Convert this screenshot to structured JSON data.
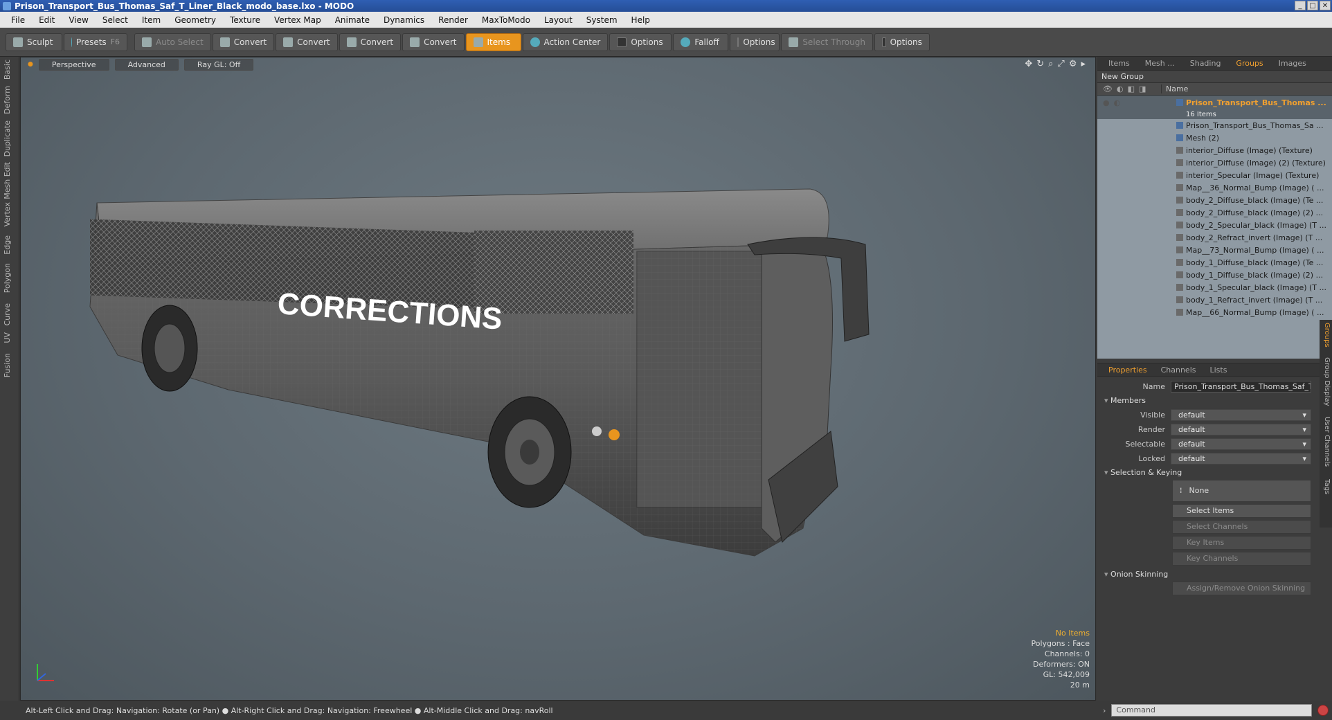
{
  "window": {
    "title": "Prison_Transport_Bus_Thomas_Saf_T_Liner_Black_modo_base.lxo - MODO"
  },
  "menu": [
    "File",
    "Edit",
    "View",
    "Select",
    "Item",
    "Geometry",
    "Texture",
    "Vertex Map",
    "Animate",
    "Dynamics",
    "Render",
    "MaxToModo",
    "Layout",
    "System",
    "Help"
  ],
  "toolbar": {
    "sculpt": "Sculpt",
    "presets": "Presets",
    "presets_key": "F6",
    "auto_select": "Auto Select",
    "convert1": "Convert",
    "convert2": "Convert",
    "convert3": "Convert",
    "convert4": "Convert",
    "items": "Items",
    "action_center": "Action Center",
    "options1": "Options",
    "falloff": "Falloff",
    "options2": "Options",
    "select_through": "Select Through",
    "options3": "Options"
  },
  "left_tabs": [
    "Basic",
    "Deform",
    "Duplicate",
    "Mesh Edit",
    "Vertex",
    "Edge",
    "Polygon",
    "Curve",
    "UV",
    "Fusion"
  ],
  "viewport": {
    "view_mode": "Perspective",
    "shading": "Advanced",
    "raygl": "Ray GL: Off",
    "bus_label": "CORRECTIONS",
    "info": {
      "items": "No Items",
      "polygons": "Polygons : Face",
      "channels": "Channels: 0",
      "deformers": "Deformers: ON",
      "gl": "GL: 542,009",
      "scale": "20 m"
    }
  },
  "right_panel": {
    "tabs": [
      "Items",
      "Mesh ...",
      "Shading",
      "Groups",
      "Images"
    ],
    "active_tab": "Groups",
    "new_group": "New Group",
    "name_header": "Name",
    "group": {
      "name": "Prison_Transport_Bus_Thomas ...",
      "count": "16 Items"
    },
    "items": [
      "Prison_Transport_Bus_Thomas_Sa ...",
      "Mesh (2)",
      "interior_Diffuse (Image) (Texture)",
      "interior_Diffuse (Image) (2) (Texture)",
      "interior_Specular (Image) (Texture)",
      "Map__36_Normal_Bump (Image) ( ...",
      "body_2_Diffuse_black (Image) (Te ...",
      "body_2_Diffuse_black (Image) (2) ...",
      "body_2_Specular_black (Image) (T ...",
      "body_2_Refract_invert (Image) (T ...",
      "Map__73_Normal_Bump (Image) ( ...",
      "body_1_Diffuse_black (Image) (Te ...",
      "body_1_Diffuse_black (Image) (2) ...",
      "body_1_Specular_black (Image) (T ...",
      "body_1_Refract_invert (Image) (T ...",
      "Map__66_Normal_Bump (Image) ( ..."
    ]
  },
  "properties": {
    "tabs": [
      "Properties",
      "Channels",
      "Lists"
    ],
    "name_label": "Name",
    "name_value": "Prison_Transport_Bus_Thomas_Saf_T",
    "members": "Members",
    "visible_label": "Visible",
    "visible": "default",
    "render_label": "Render",
    "render": "default",
    "selectable_label": "Selectable",
    "selectable": "default",
    "locked_label": "Locked",
    "locked": "default",
    "selection_keying": "Selection & Keying",
    "none": "None",
    "select_items": "Select Items",
    "select_channels": "Select Channels",
    "key_items": "Key Items",
    "key_channels": "Key Channels",
    "onion_skinning": "Onion Skinning",
    "assign_remove": "Assign/Remove Onion Skinning",
    "side_tabs": [
      "Groups",
      "Group Display",
      "User Channels",
      "Tags"
    ]
  },
  "status": {
    "hint": "Alt-Left Click and Drag: Navigation: Rotate (or Pan) ● Alt-Right Click and Drag: Navigation: Freewheel ● Alt-Middle Click and Drag: navRoll",
    "command_placeholder": "Command"
  }
}
